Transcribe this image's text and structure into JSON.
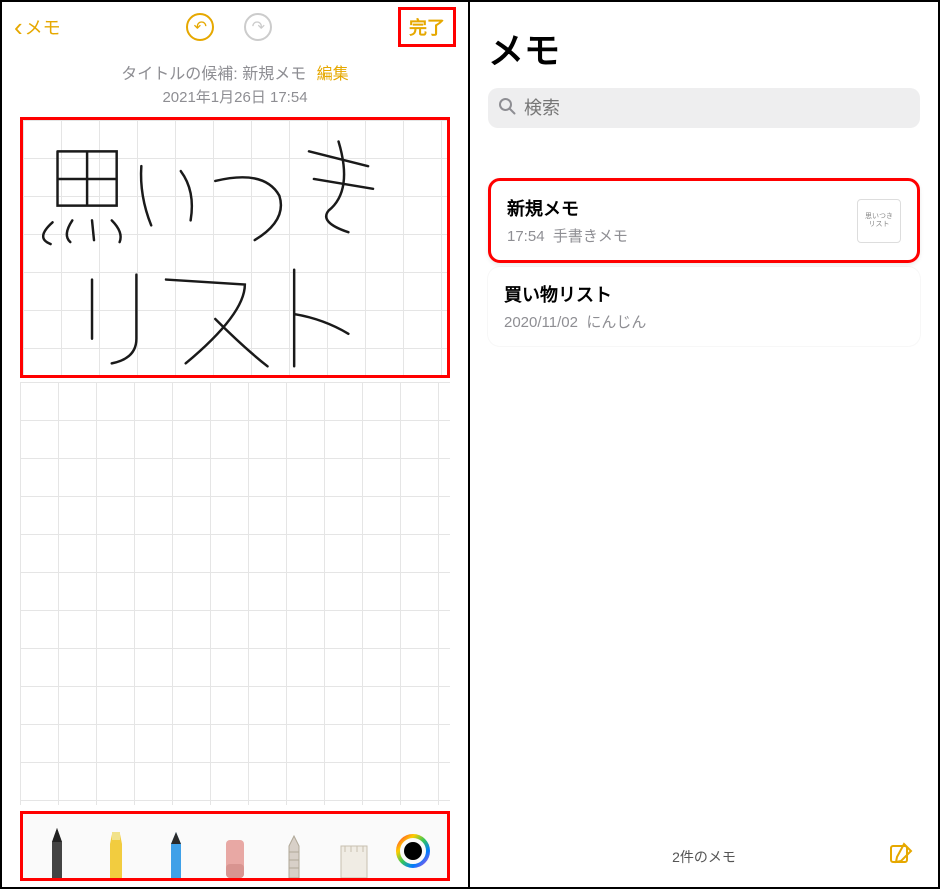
{
  "editor": {
    "back_label": "メモ",
    "done_label": "完了",
    "title_suggestion_prefix": "タイトルの候補: ",
    "title_suggestion": "新規メモ",
    "edit_label": "編集",
    "timestamp": "2021年1月26日 17:54",
    "handwriting_text_line1": "思いつき",
    "handwriting_text_line2": "リスト",
    "tools": {
      "pen": "pen",
      "marker": "marker",
      "pencil": "pencil",
      "eraser": "eraser",
      "lasso": "lasso",
      "ruler": "ruler",
      "color_picker": "color-picker"
    }
  },
  "list": {
    "title": "メモ",
    "search_placeholder": "検索",
    "items": [
      {
        "title": "新規メモ",
        "time": "17:54",
        "preview": "手書きメモ",
        "thumbnail_text": "思いつき\nリスト"
      },
      {
        "title": "買い物リスト",
        "time": "2020/11/02",
        "preview": "にんじん"
      }
    ],
    "footer_count": "2件のメモ"
  }
}
